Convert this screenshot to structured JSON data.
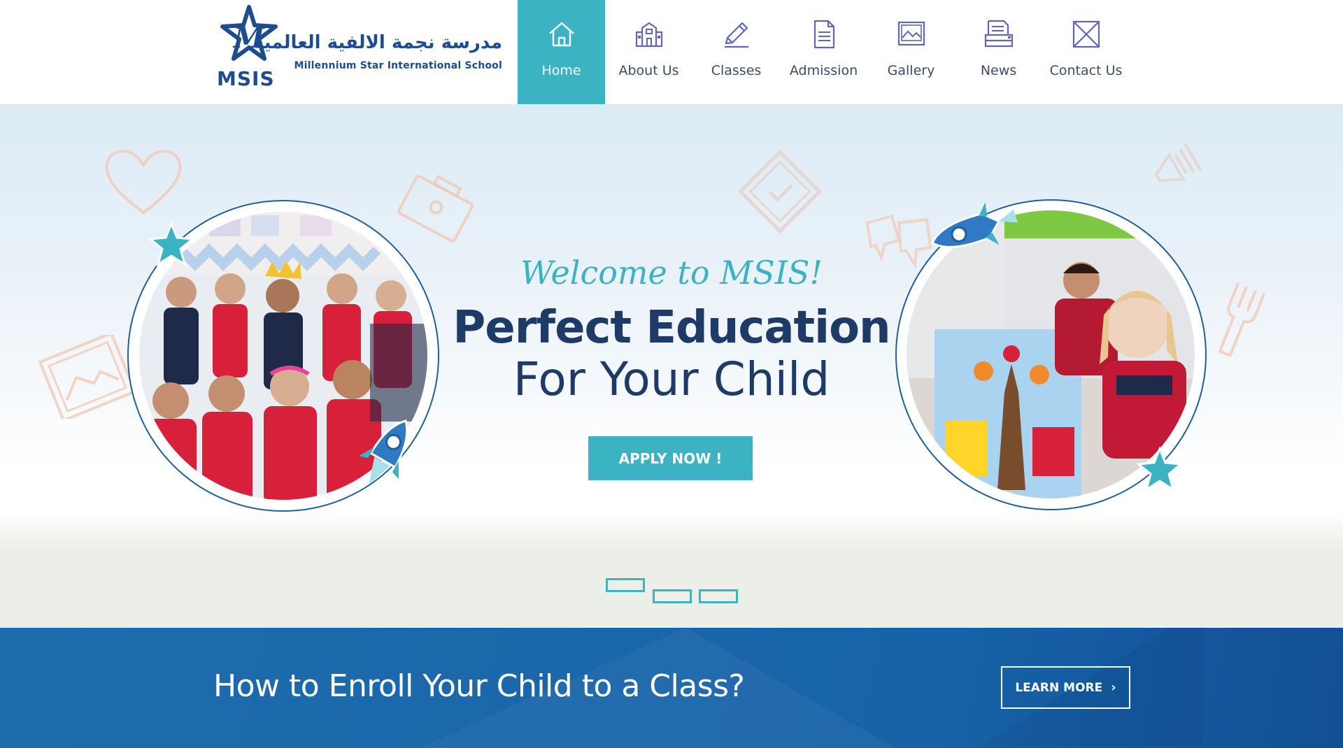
{
  "header": {
    "logo": {
      "arabic_name": "مدرسة نجمة الالفية العالمية",
      "english_name": "Millennium Star International School",
      "abbreviation": "MSIS"
    },
    "nav": [
      {
        "label": "Home",
        "icon": "home-icon",
        "active": true
      },
      {
        "label": "About Us",
        "icon": "school-building-icon",
        "active": false
      },
      {
        "label": "Classes",
        "icon": "pencil-icon",
        "active": false
      },
      {
        "label": "Admission",
        "icon": "document-icon",
        "active": false
      },
      {
        "label": "Gallery",
        "icon": "picture-icon",
        "active": false
      },
      {
        "label": "News",
        "icon": "newspaper-icon",
        "active": false
      },
      {
        "label": "Contact Us",
        "icon": "envelope-icon",
        "active": false
      }
    ]
  },
  "hero": {
    "welcome": "Welcome to MSIS!",
    "headline": "Perfect Education",
    "subhead": "For Your Child",
    "apply_button": "APPLY NOW !",
    "slider": {
      "slide_count": 3,
      "active_index": 0
    }
  },
  "enroll": {
    "title": "How to Enroll Your Child to a Class?",
    "button": "LEARN MORE",
    "button_icon": "chevron-right-icon"
  },
  "colors": {
    "accent": "#3bb3c3",
    "brand_blue": "#1d4c8f",
    "headline": "#1e3a66",
    "banner": "#1b67ab",
    "decor": "#f2c9b3"
  }
}
